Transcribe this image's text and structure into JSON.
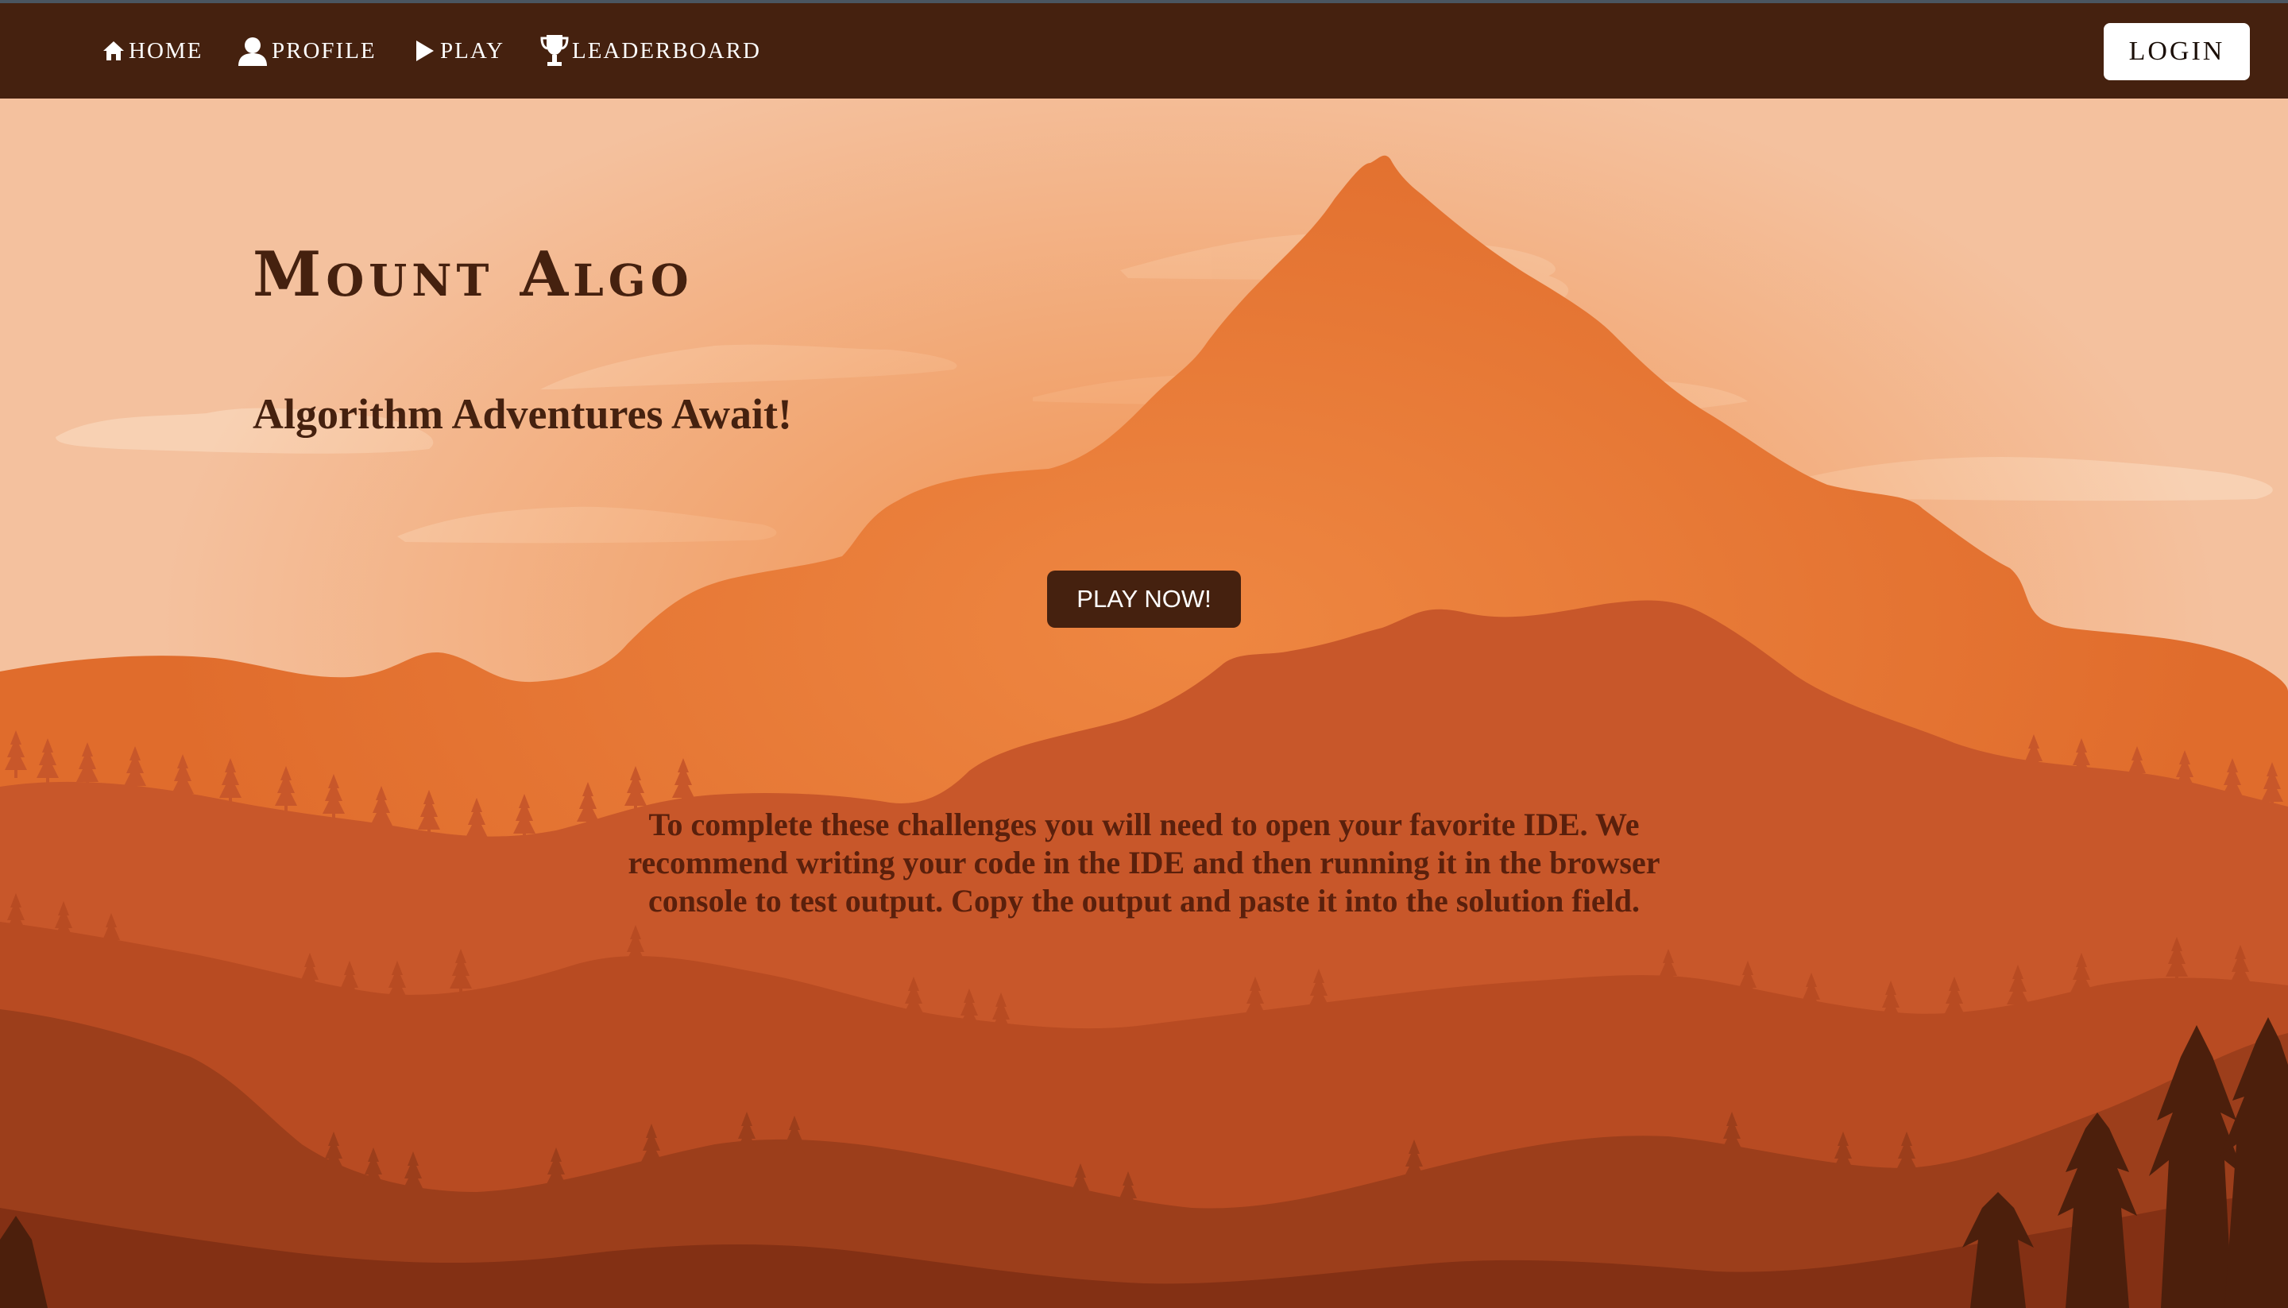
{
  "nav": {
    "home": {
      "label": "HOME",
      "icon": "home-icon"
    },
    "profile": {
      "label": "PROFILE",
      "icon": "user-icon"
    },
    "play": {
      "label": "PLAY",
      "icon": "play-icon"
    },
    "leaderboard": {
      "label": "LEADERBOARD",
      "icon": "trophy-icon"
    },
    "login_label": "LOGIN"
  },
  "hero": {
    "brand": "Mount Algo",
    "subtitle": "Algorithm Adventures Await!",
    "play_button": "PLAY NOW!",
    "instructions": "To complete these challenges you will need to open your favorite IDE. We recommend writing your code in the IDE and then running it in the browser console to test output. Copy the output and paste it into the solution field."
  },
  "colors": {
    "navbar": "#45210f",
    "sky": "#f4c19e",
    "mountain": "#e06c2c",
    "accent_dark": "#45210f",
    "login_bg": "#ffffff"
  }
}
